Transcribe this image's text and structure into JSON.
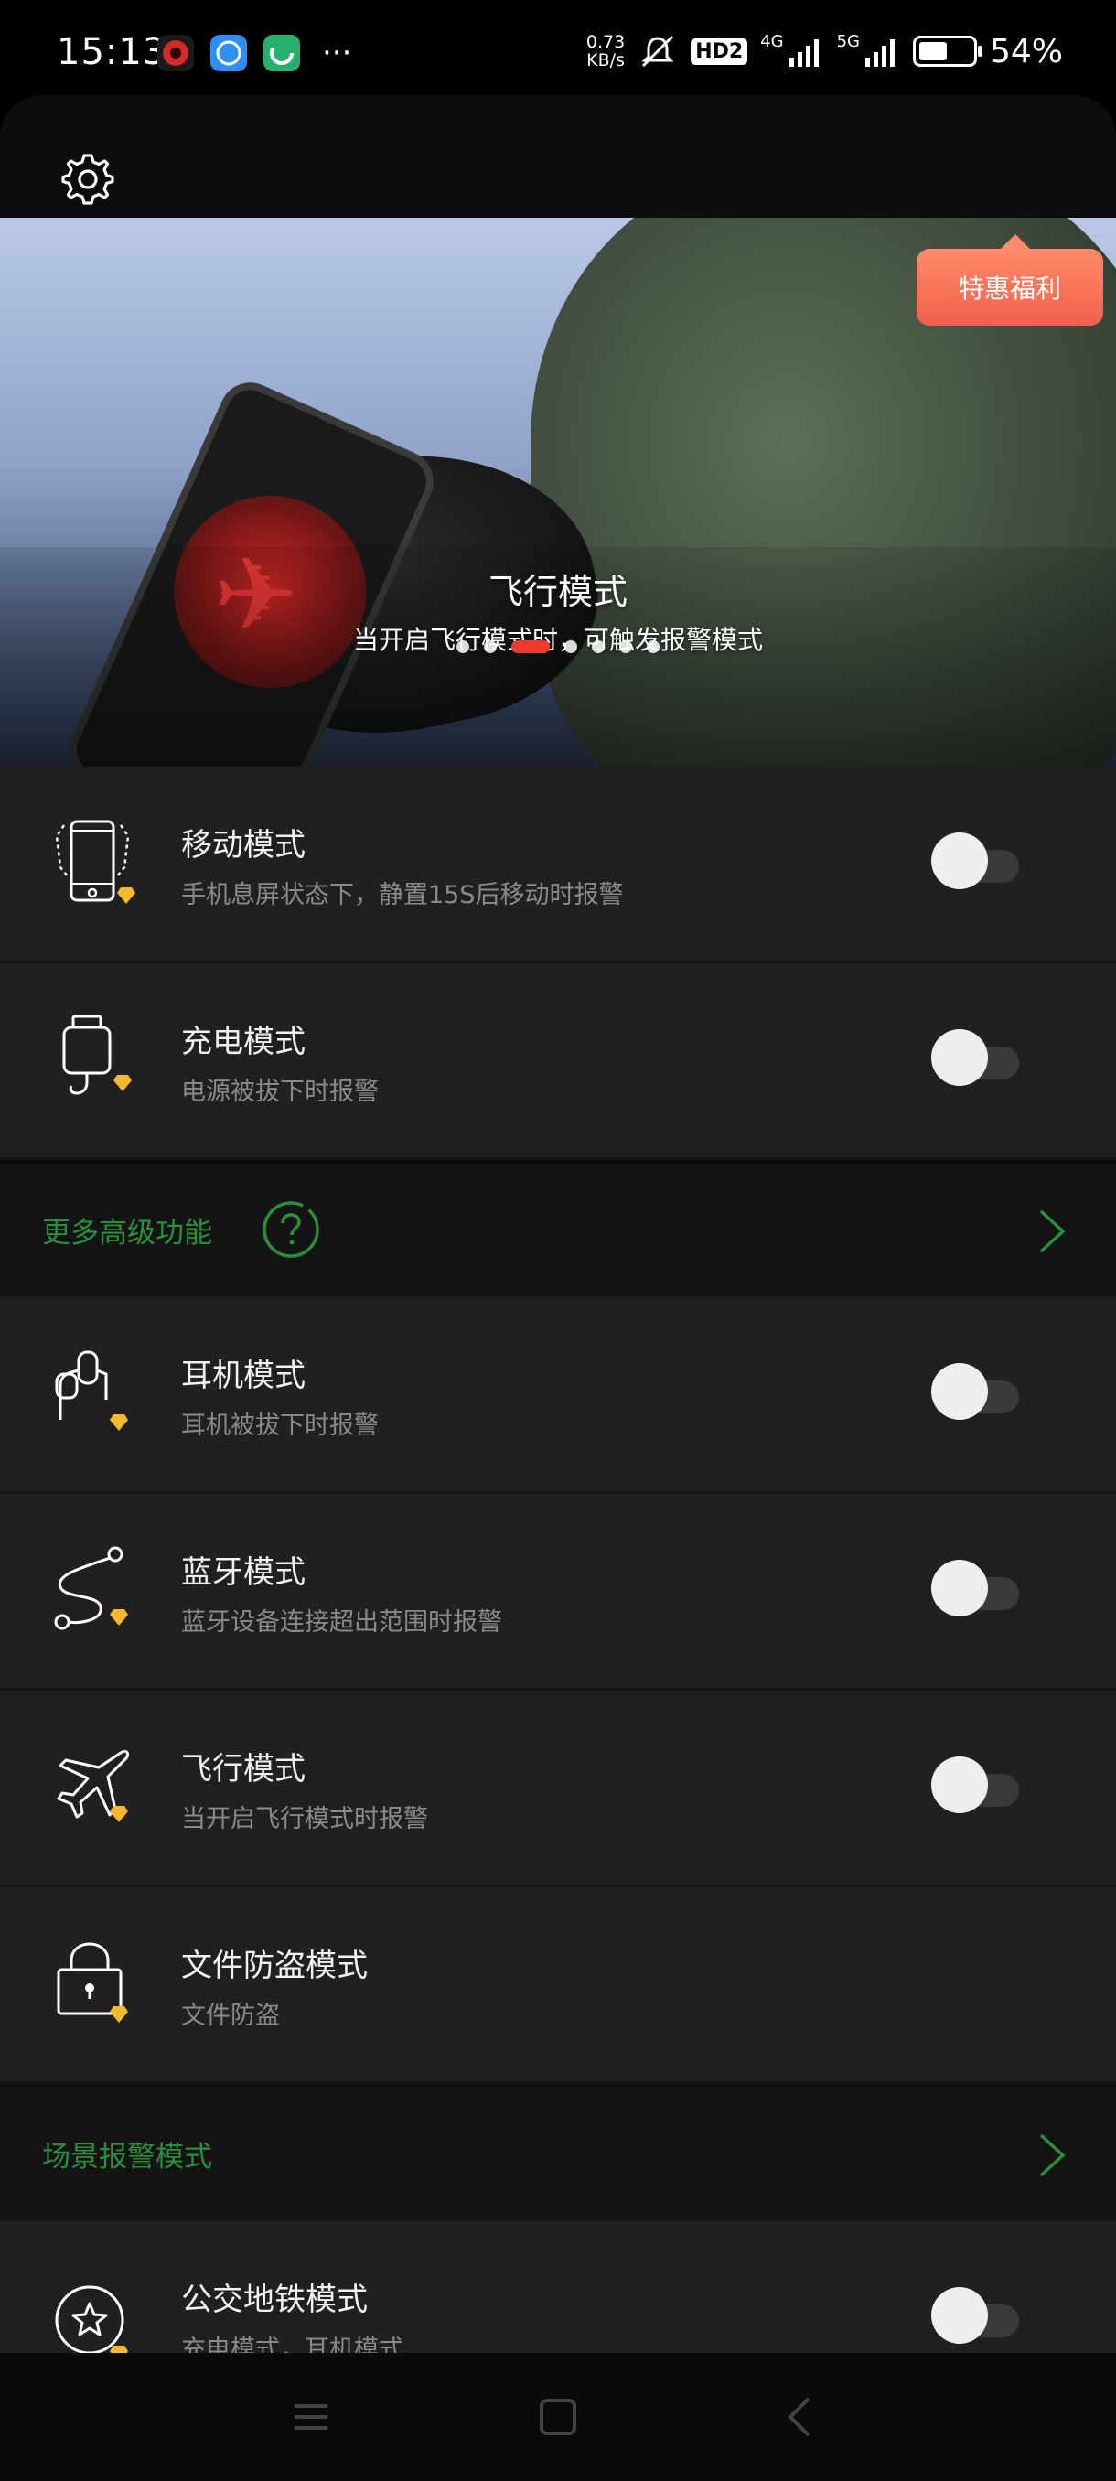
{
  "status_bar": {
    "time": "15:13",
    "net_speed_value": "0.73",
    "net_speed_unit": "KB/s",
    "hd_badge": "HD2",
    "net_type_1": "4G",
    "net_type_2": "5G",
    "battery_percent": "54%",
    "battery_level": 0.54,
    "more_indicator": "···"
  },
  "banner": {
    "title": "飞行模式",
    "subtitle": "当开启飞行模式时，可触发报警模式",
    "promo_label": "特惠福利",
    "dot_count": 7,
    "active_dot": 2
  },
  "modes_group_1": [
    {
      "title": "移动模式",
      "subtitle": "手机息屏状态下，静置15S后移动时报警",
      "icon": "phone-motion-icon",
      "enabled": false
    },
    {
      "title": "充电模式",
      "subtitle": "电源被拔下时报警",
      "icon": "charger-icon",
      "enabled": false
    }
  ],
  "advanced_section": {
    "label": "更多高级功能"
  },
  "modes_group_2": [
    {
      "title": "耳机模式",
      "subtitle": "耳机被拔下时报警",
      "icon": "earphone-icon",
      "enabled": false
    },
    {
      "title": "蓝牙模式",
      "subtitle": "蓝牙设备连接超出范围时报警",
      "icon": "bluetooth-path-icon",
      "enabled": false
    },
    {
      "title": "飞行模式",
      "subtitle": "当开启飞行模式时报警",
      "icon": "airplane-icon",
      "enabled": false
    },
    {
      "title": "文件防盗模式",
      "subtitle": "文件防盗",
      "icon": "lock-icon"
    }
  ],
  "scene_section": {
    "label": "场景报警模式"
  },
  "modes_group_3": [
    {
      "title": "公交地铁模式",
      "subtitle": "充电模式，耳机模式",
      "icon": "star-badge-icon",
      "enabled": false
    }
  ],
  "colors": {
    "accent_green": "#2b8f3c",
    "premium_gold": "#f5b82e",
    "promo_orange": "#f2604d",
    "active_dot_red": "#ee3a2c"
  }
}
